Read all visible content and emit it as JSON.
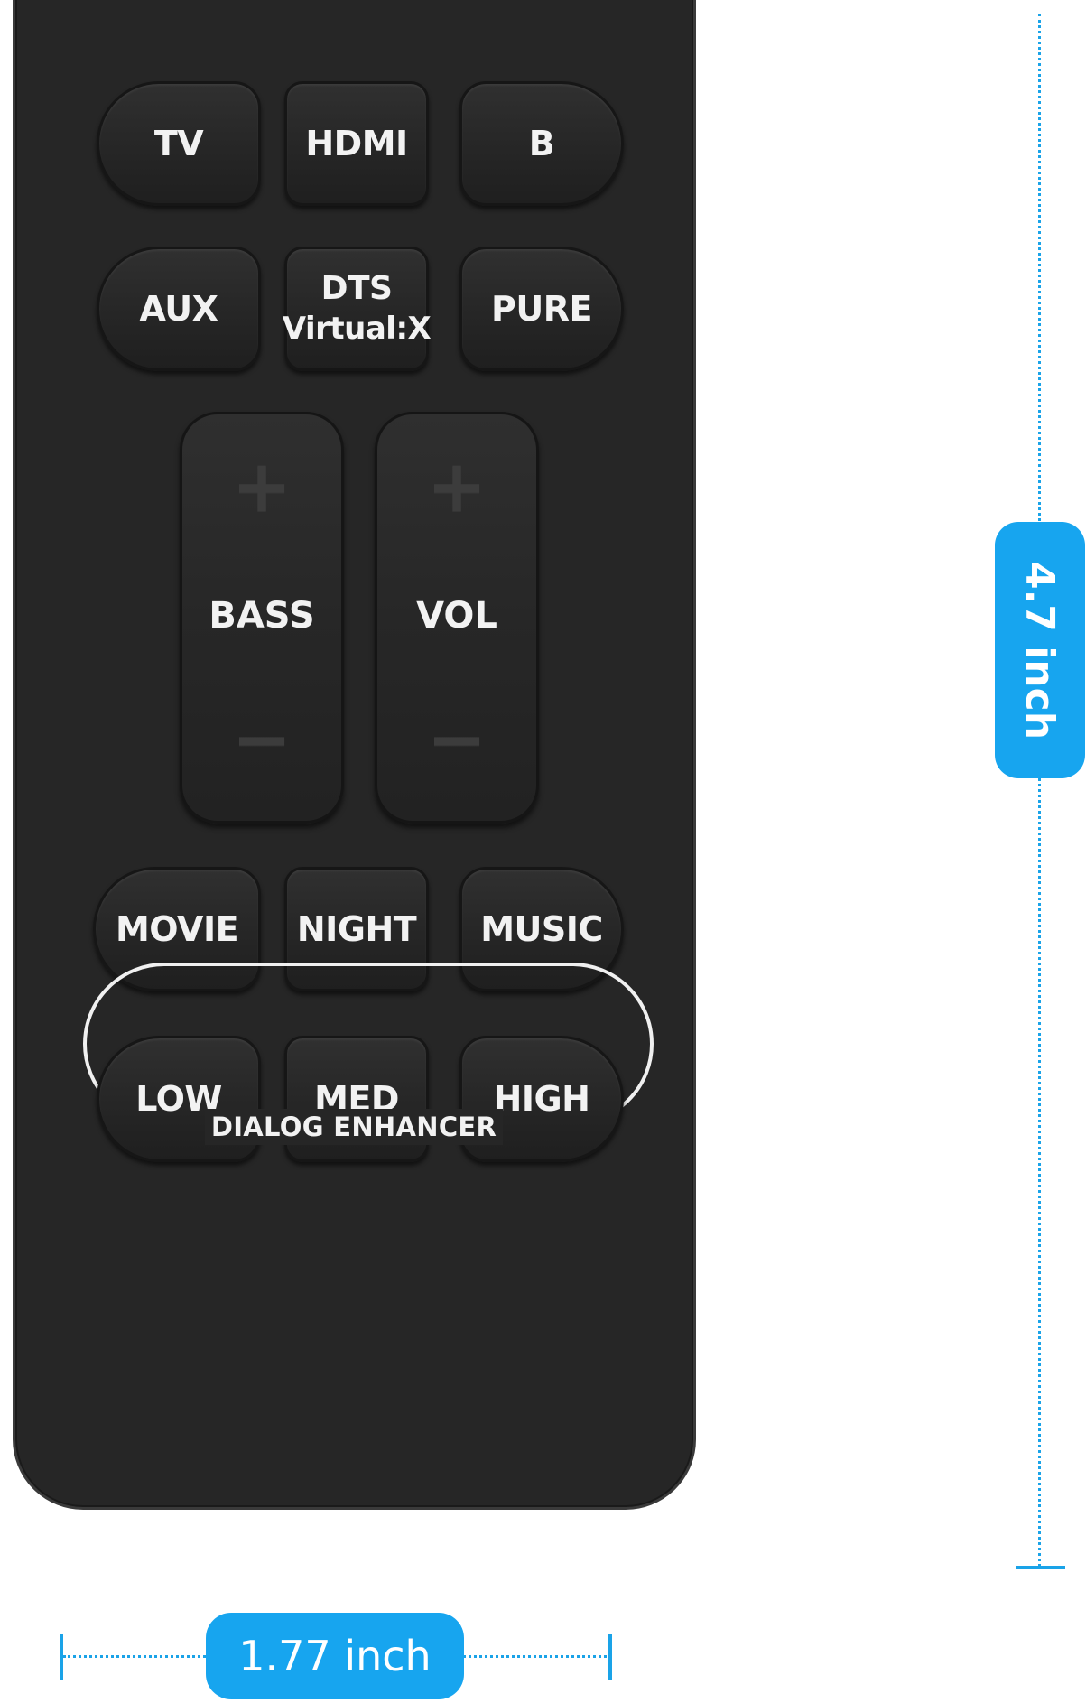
{
  "row1": {
    "tv": "TV",
    "hdmi": "HDMI",
    "b": "B"
  },
  "row2": {
    "aux": "AUX",
    "dts_line1": "DTS",
    "dts_line2": "Virtual:X",
    "pure": "PURE"
  },
  "rockers": {
    "bass": {
      "label": "BASS",
      "plus": "+",
      "minus": "−"
    },
    "vol": {
      "label": "VOL",
      "plus": "+",
      "minus": "−"
    }
  },
  "row3": {
    "movie": "MOVIE",
    "night": "NIGHT",
    "music": "MUSIC"
  },
  "dialog": {
    "low": "LOW",
    "med": "MED",
    "high": "HIGH",
    "group_label": "DIALOG ENHANCER"
  },
  "dimensions": {
    "height": "4.7 inch",
    "width": "1.77 inch"
  },
  "colors": {
    "remote_body": "#262626",
    "button": "#2a2a2a",
    "accent": "#17a5ef",
    "button_text": "#f2f2f2"
  }
}
